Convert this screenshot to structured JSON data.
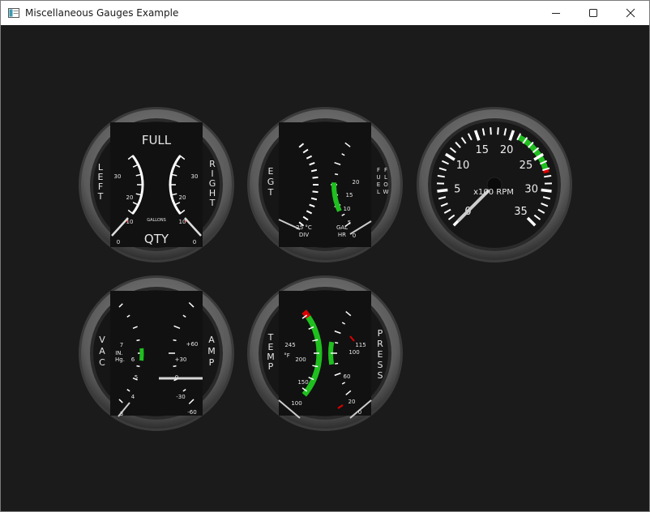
{
  "window": {
    "title": "Miscellaneous Gauges Example"
  },
  "fuel_qty": {
    "top_label": "FULL",
    "bottom_label": "QTY",
    "units": "GALLONS",
    "left_label": [
      "L",
      "E",
      "F",
      "T"
    ],
    "right_label": [
      "R",
      "I",
      "G",
      "H",
      "T"
    ],
    "scale": [
      "30",
      "20",
      "10",
      "0"
    ],
    "left_value": 0,
    "right_value": 0
  },
  "egt_fuel_flow": {
    "left_label": [
      "E",
      "G",
      "T"
    ],
    "right_label_col1": [
      "F",
      "U",
      "E",
      "L"
    ],
    "right_label_col2": [
      "F",
      "L",
      "O",
      "W"
    ],
    "egt_units_line1": "25 °C",
    "egt_units_line2": "DIV",
    "flow_units_line1": "GAL",
    "flow_units_line2": "HR",
    "flow_scale": [
      "20",
      "15",
      "10",
      "5",
      "0"
    ]
  },
  "tachometer": {
    "units": "x100 RPM",
    "scale": [
      "0",
      "5",
      "10",
      "15",
      "20",
      "25",
      "30",
      "35"
    ],
    "value": 0,
    "green_band": [
      21,
      27
    ],
    "red_line": 27
  },
  "vac_amp": {
    "left_label": [
      "V",
      "A",
      "C"
    ],
    "right_label": [
      "A",
      "M",
      "P"
    ],
    "vac_units_line1": "IN.",
    "vac_units_line2": "Hg.",
    "vac_scale": [
      "7",
      "6",
      "5",
      "4",
      "3"
    ],
    "amp_scale": [
      "+60",
      "+30",
      "0",
      "-30",
      "-60"
    ],
    "amp_value": 0
  },
  "temp_press": {
    "left_label": [
      "T",
      "E",
      "M",
      "P"
    ],
    "right_label": [
      "P",
      "R",
      "E",
      "S",
      "S"
    ],
    "temp_units": "°F",
    "temp_scale": [
      "245",
      "200",
      "150",
      "100"
    ],
    "press_scale": [
      "115",
      "100",
      "60",
      "20",
      "0"
    ]
  }
}
